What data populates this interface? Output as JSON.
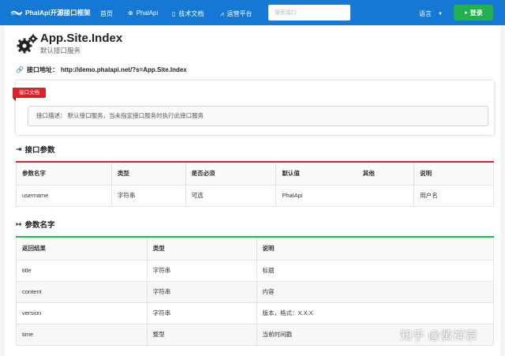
{
  "navbar": {
    "brand": "PhalApi开源接口框架",
    "items": [
      {
        "icon": "home-icon",
        "label": "首页"
      },
      {
        "icon": "globe-icon",
        "label": "PhalApi"
      },
      {
        "icon": "file-icon",
        "label": "技术文档"
      },
      {
        "icon": "chart-icon",
        "label": "运营平台"
      }
    ],
    "search_placeholder": "搜索接口",
    "language": "语言",
    "login": "登录"
  },
  "colors": {
    "navbar": "#1478d4",
    "login": "#22b14c",
    "ribbon": "#d8232a",
    "green_rule": "#21ba45"
  },
  "api": {
    "title": "App.Site.Index",
    "subtitle": "默认接口服务",
    "url_label": "接口地址：",
    "url": "http://demo.phalapi.net/?s=App.Site.Index"
  },
  "doc": {
    "ribbon": "接口文档",
    "description": "接口描述：  默认接口服务，当未指定接口服务时执行此接口服务"
  },
  "params_section": {
    "title": "接口参数",
    "headers": [
      "参数名字",
      "类型",
      "是否必须",
      "默认值",
      "其他",
      "说明"
    ],
    "rows": [
      [
        "username",
        "字符串",
        "可选",
        "PhalApi",
        "",
        "用户名"
      ]
    ]
  },
  "return_section": {
    "title": "参数名字",
    "headers": [
      "返回结果",
      "类型",
      "说明"
    ],
    "rows": [
      [
        "title",
        "字符串",
        "标题"
      ],
      [
        "content",
        "字符串",
        "内容"
      ],
      [
        "version",
        "字符串",
        "版本，格式：X.X.X"
      ],
      [
        "time",
        "整型",
        "当前时间戳"
      ]
    ]
  },
  "watermark": "知乎 @黄祥宗"
}
